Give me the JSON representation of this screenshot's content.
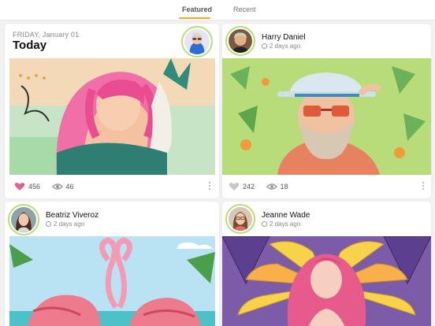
{
  "tabs": {
    "featured_label": "Featured",
    "recent_label": "Recent",
    "active": "Featured"
  },
  "accent_color": "#f5a623",
  "avatar_ring_color": "#b4e079",
  "cards": [
    {
      "header": {
        "date_small": "FRIDAY, January 01",
        "title": "Today"
      },
      "likes": "456",
      "views": "46",
      "liked": true,
      "artwork": "woman-with-mask-icon"
    },
    {
      "user": "Harry Daniel",
      "time": "2 days ago",
      "likes": "242",
      "views": "18",
      "liked": false,
      "artwork": "bearded-man-with-hat-icon"
    },
    {
      "user": "Beatriz Viveroz",
      "time": "2 days ago",
      "artwork": "flamingos-icon"
    },
    {
      "user": "Jeanne Wade",
      "time": "2 days ago",
      "artwork": "stained-glass-woman-icon"
    }
  ]
}
